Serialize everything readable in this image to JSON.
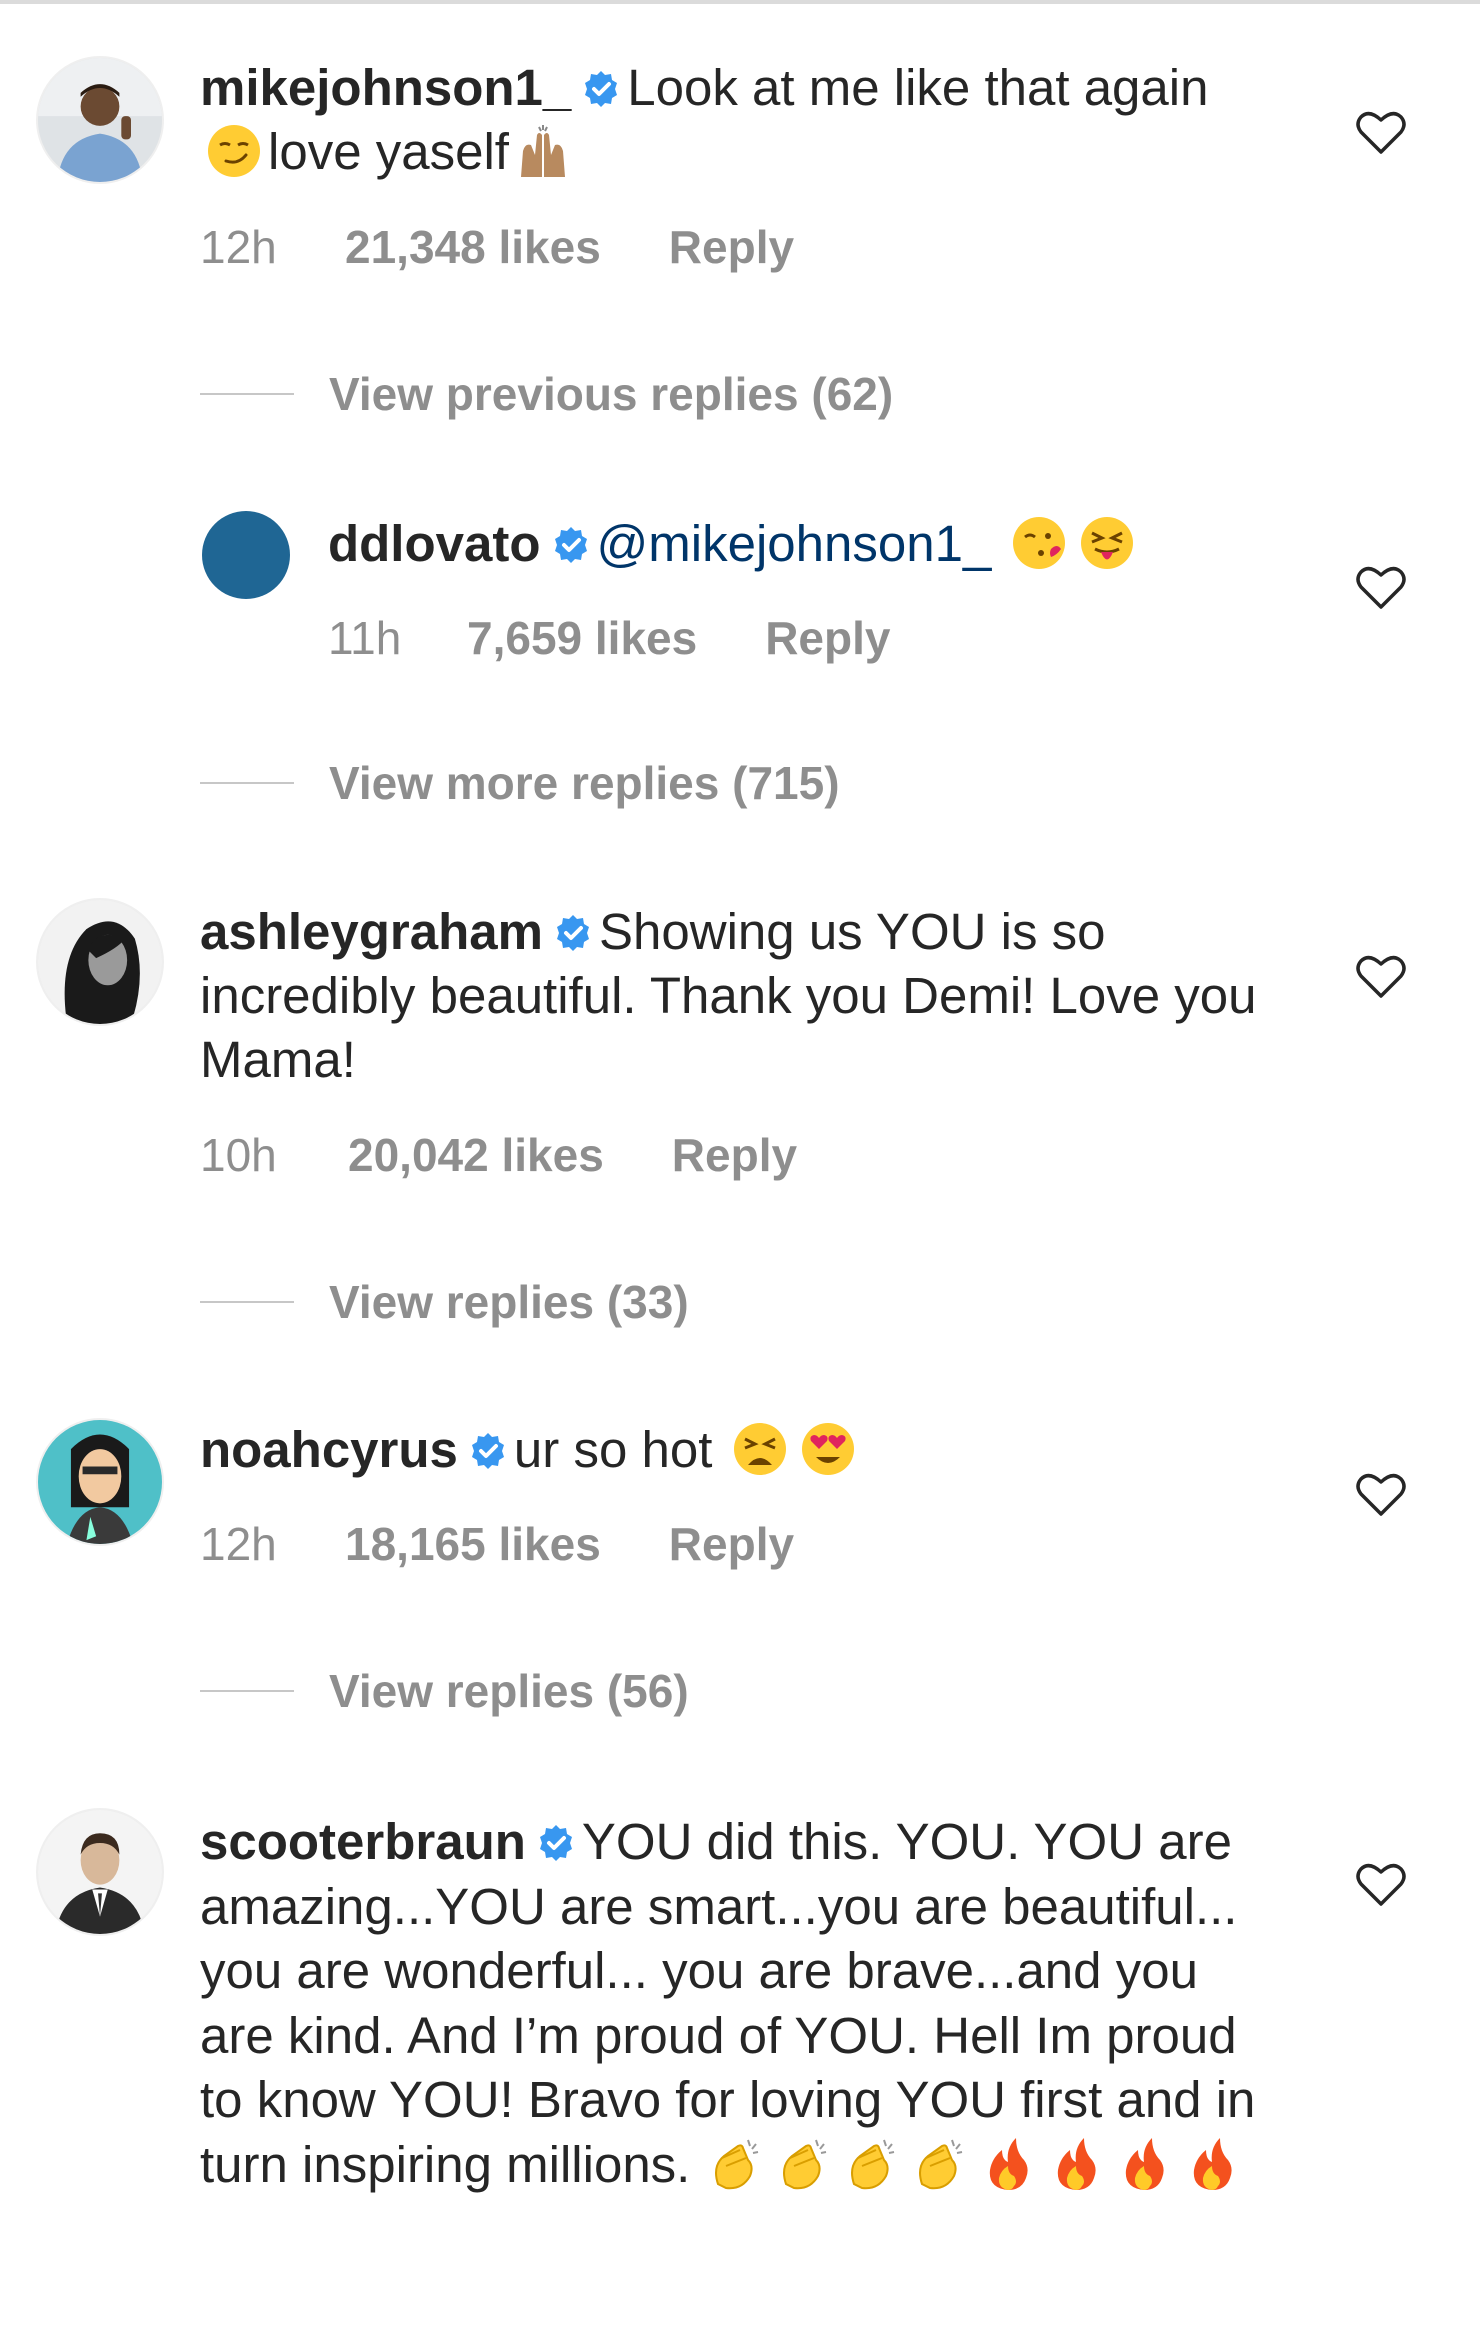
{
  "comments": [
    {
      "username": "mikejohnson1_",
      "text_parts": [
        "Look at me like that again",
        "love yaself"
      ],
      "emojis": [
        "smirk-emoji",
        "raised-hands-emoji"
      ],
      "time": "12h",
      "likes": "21,348 likes",
      "reply_label": "Reply",
      "view_replies": "View previous replies (62)"
    },
    {
      "username": "ddlovato",
      "mention": "@mikejohnson1_",
      "emojis": [
        "kiss-emoji",
        "tongue-emoji"
      ],
      "time": "11h",
      "likes": "7,659 likes",
      "reply_label": "Reply",
      "view_replies": "View more replies (715)"
    },
    {
      "username": "ashleygraham",
      "text": "Showing us YOU is so incredibly beautiful. Thank you Demi! Love you Mama!",
      "time": "10h",
      "likes": "20,042 likes",
      "reply_label": "Reply",
      "view_replies": "View replies (33)"
    },
    {
      "username": "noahcyrus",
      "text": "ur so hot",
      "emojis": [
        "tired-face-emoji",
        "heart-eyes-emoji"
      ],
      "time": "12h",
      "likes": "18,165 likes",
      "reply_label": "Reply",
      "view_replies": "View replies (56)"
    },
    {
      "username": "scooterbraun",
      "text": "YOU did this. YOU. YOU are amazing...YOU are smart...you are beautiful... you are wonderful... you are brave...and you are kind. And I’m proud of YOU. Hell Im proud to know YOU! Bravo for loving YOU first and in turn inspiring millions.",
      "emojis": [
        "clap-emoji",
        "clap-emoji",
        "clap-emoji",
        "clap-emoji",
        "fire-emoji",
        "fire-emoji",
        "fire-emoji",
        "fire-emoji"
      ]
    }
  ],
  "colors": {
    "text": "#262626",
    "meta": "#8e8e8e",
    "verified": "#3897f0",
    "mention": "#003569",
    "ddlovato_avatar": "#1f6694"
  }
}
